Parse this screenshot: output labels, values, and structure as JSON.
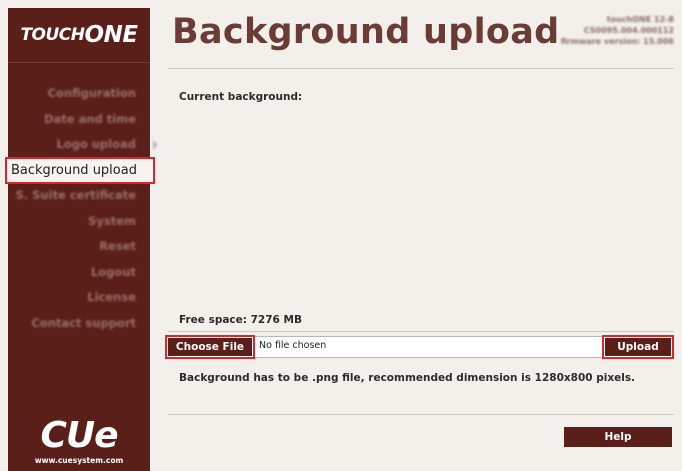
{
  "brand": {
    "prefix": "TOUCH",
    "suffix": "ONE"
  },
  "page": {
    "title": "Background upload"
  },
  "device_info": {
    "line1": "touchONE 12-8",
    "line2": "CS0095.004.000112",
    "line3": "firmware version: 15.006"
  },
  "nav": {
    "items": [
      {
        "label": "Configuration"
      },
      {
        "label": "Date and time"
      },
      {
        "label": "Logo upload"
      },
      {
        "label": "Background upload",
        "active": true
      },
      {
        "label": "S. Suite certificate"
      },
      {
        "label": "System"
      },
      {
        "label": "Reset"
      },
      {
        "label": "Logout"
      },
      {
        "label": "License"
      },
      {
        "label": "Contact support"
      }
    ]
  },
  "content": {
    "current_label": "Current background:",
    "free_space": "Free space: 7276 MB",
    "choose_file_label": "Choose File",
    "file_status": "No file chosen",
    "upload_label": "Upload",
    "hint": "Background has to be .png file, recommended dimension is 1280x800 pixels.",
    "help_label": "Help"
  },
  "footer": {
    "logo": "CUe",
    "url": "www.cuesystem.com"
  },
  "colors": {
    "sidebar": "#5a1f19",
    "title": "#6b3b35",
    "background": "#f3f0ec",
    "highlight": "#d9262c"
  }
}
